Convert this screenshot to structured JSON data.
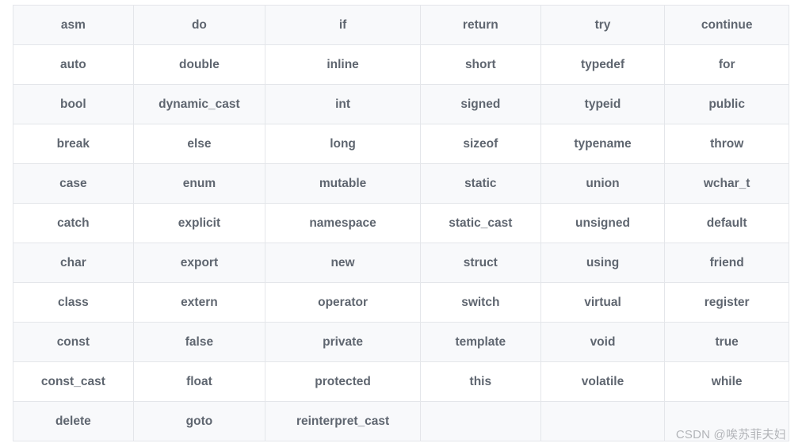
{
  "chart_data": {
    "type": "table",
    "title": "",
    "columns": 6,
    "rows": [
      [
        "asm",
        "do",
        "if",
        "return",
        "try",
        "continue"
      ],
      [
        "auto",
        "double",
        "inline",
        "short",
        "typedef",
        "for"
      ],
      [
        "bool",
        "dynamic_cast",
        "int",
        "signed",
        "typeid",
        "public"
      ],
      [
        "break",
        "else",
        "long",
        "sizeof",
        "typename",
        "throw"
      ],
      [
        "case",
        "enum",
        "mutable",
        "static",
        "union",
        "wchar_t"
      ],
      [
        "catch",
        "explicit",
        "namespace",
        "static_cast",
        "unsigned",
        "default"
      ],
      [
        "char",
        "export",
        "new",
        "struct",
        "using",
        "friend"
      ],
      [
        "class",
        "extern",
        "operator",
        "switch",
        "virtual",
        "register"
      ],
      [
        "const",
        "false",
        "private",
        "template",
        "void",
        "true"
      ],
      [
        "const_cast",
        "float",
        "protected",
        "this",
        "volatile",
        "while"
      ],
      [
        "delete",
        "goto",
        "reinterpret_cast",
        "",
        "",
        ""
      ]
    ]
  },
  "watermark": "CSDN @唉苏菲夫妇"
}
